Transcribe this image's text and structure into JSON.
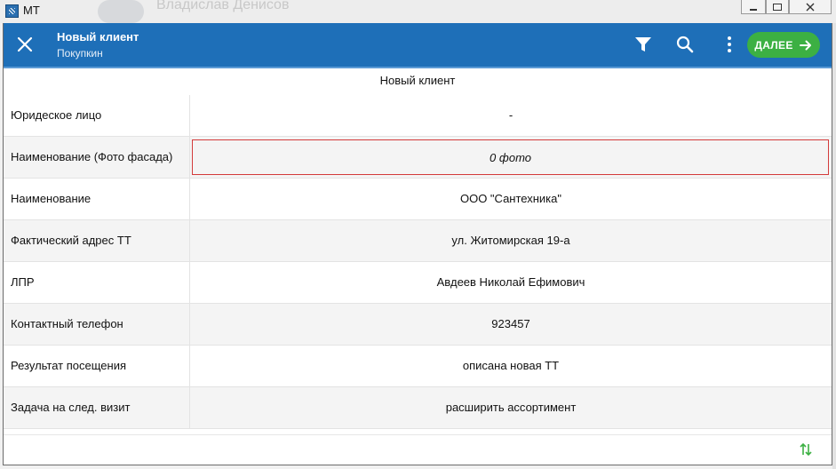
{
  "window": {
    "app_title": "МТ",
    "background_text": "Владислав Денисов"
  },
  "appbar": {
    "title": "Новый клиент",
    "subtitle": "Покупкин",
    "next_label": "ДАЛЕЕ",
    "icons": [
      "close-icon",
      "filter-icon",
      "search-icon",
      "more-vert-icon",
      "arrow-right-icon"
    ],
    "colors": {
      "bar": "#1e6fb8",
      "next": "#3cb043"
    }
  },
  "section_title": "Новый клиент",
  "rows": [
    {
      "label": "Юридеское лицо",
      "value": "-"
    },
    {
      "label": "Наименование (Фото фасада)",
      "value": "0 фото"
    },
    {
      "label": "Наименование",
      "value": "ООО \"Сантехника\""
    },
    {
      "label": "Фактический адрес ТТ",
      "value": "ул. Житомирская 19-а"
    },
    {
      "label": "ЛПР",
      "value": "Авдеев Николай Ефимович"
    },
    {
      "label": "Контактный телефон",
      "value": "923457"
    },
    {
      "label": "Результат посещения",
      "value": "описана новая ТТ"
    },
    {
      "label": "Задача на след. визит",
      "value": "расширить ассортимент"
    }
  ]
}
